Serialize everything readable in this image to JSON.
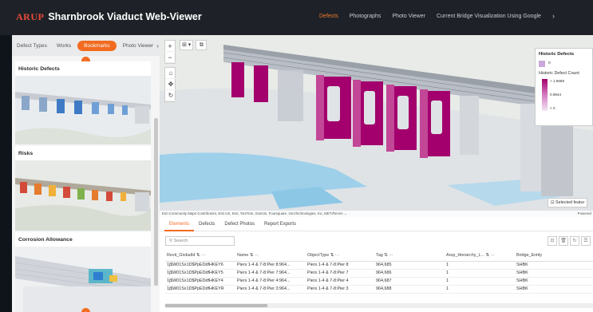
{
  "header": {
    "logo": "ARUP",
    "title": "Sharnbrook Viaduct Web-Viewer",
    "nav": [
      "Defects",
      "Photographs",
      "Photo Viewer",
      "Current Bridge Visualization Using Google"
    ],
    "active_nav": "Defects"
  },
  "left_panel": {
    "tabs": [
      "Defect Types",
      "Works",
      "Bookmarks",
      "Photo Viewer"
    ],
    "active_tab": "Bookmarks",
    "cards": [
      {
        "title": "Historic Defects"
      },
      {
        "title": "Risks"
      },
      {
        "title": "Corrosion Allowance"
      }
    ]
  },
  "map": {
    "attribution": "Esri Community Maps Contributors, Esri UK, Esri, TomTom, Garmin, Foursquare, GeoTechnologies, Inc, METI/NASA",
    "powered": "Powered",
    "selected_features": "Selected featur"
  },
  "legend": {
    "title": "Historic Defects",
    "zero": "0",
    "subtitle": "Historic Defect Count",
    "ticks": [
      "> 1.9688",
      "0.9844",
      "< 0"
    ]
  },
  "table": {
    "tabs": [
      "Elements",
      "Defects",
      "Defect Photos",
      "Report Exports"
    ],
    "active_tab": "Elements",
    "search_placeholder": "Search",
    "columns": [
      "Revit_GlobalId",
      "Name",
      "ObjectType",
      "Tag",
      "Arup_Hierarchy_L...",
      "Bridge_Entity"
    ],
    "rows": [
      [
        "1j$W01Sx1D$PpEDdfHKEY6",
        "Piers 1-4 & 7-8:Pier 8:964...",
        "Piers 1-4 & 7-8:Pier 8",
        "964,685",
        "1",
        "SHBK"
      ],
      [
        "1j$W01Sx1D$PpEDdfHKEY5",
        "Piers 1-4 & 7-8:Pier 7:964...",
        "Piers 1-4 & 7-8:Pier 7",
        "964,686",
        "1",
        "SHBK"
      ],
      [
        "1j$W01Sx1D$PpEDdfHKEY4",
        "Piers 1-4 & 7-8:Pier 4:964...",
        "Piers 1-4 & 7-8:Pier 4",
        "964,687",
        "1",
        "SHBK"
      ],
      [
        "1j$W01Sx1D$PpEDdfHKEYR",
        "Piers 1-4 & 7-8:Pier 3:964...",
        "Piers 1-4 & 7-8:Pier 3",
        "964,688",
        "1",
        "SHBK"
      ]
    ]
  },
  "colors": {
    "accent": "#f26b21",
    "pier_magenta": "#a3006d",
    "header_bg": "#1e2228"
  }
}
